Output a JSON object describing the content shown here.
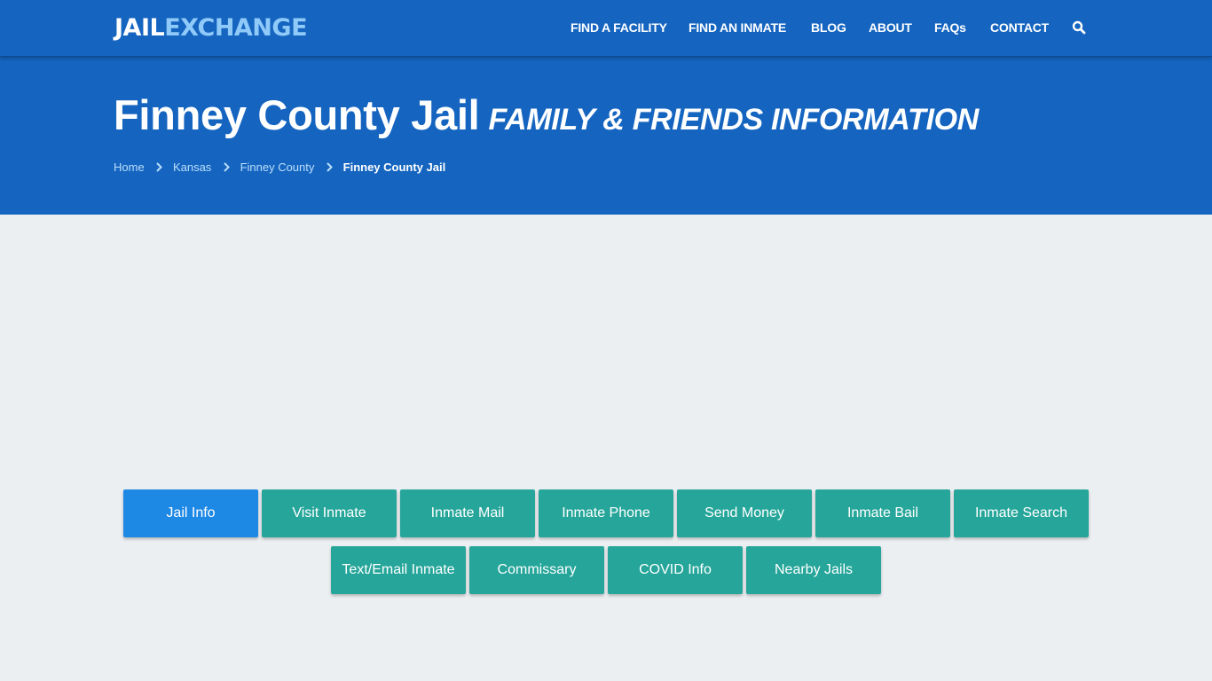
{
  "logo": {
    "part1": "JAIL",
    "part2": "EXCHANGE"
  },
  "nav": {
    "items": [
      {
        "label": "FIND A FACILITY"
      },
      {
        "label": "FIND AN INMATE"
      },
      {
        "label": "BLOG"
      },
      {
        "label": "ABOUT"
      },
      {
        "label": "FAQs"
      },
      {
        "label": "CONTACT"
      }
    ],
    "search_icon": "search-icon"
  },
  "hero": {
    "title": "Finney County Jail",
    "subtitle": "FAMILY & FRIENDS INFORMATION",
    "breadcrumb": [
      {
        "label": "Home"
      },
      {
        "label": "Kansas"
      },
      {
        "label": "Finney County"
      },
      {
        "label": "Finney County Jail"
      }
    ]
  },
  "buttons": {
    "row1": [
      {
        "label": "Jail Info",
        "active": true
      },
      {
        "label": "Visit Inmate"
      },
      {
        "label": "Inmate Mail"
      },
      {
        "label": "Inmate Phone"
      },
      {
        "label": "Send Money"
      },
      {
        "label": "Inmate Bail"
      },
      {
        "label": "Inmate Search"
      }
    ],
    "row2": [
      {
        "label": "Text/Email Inmate"
      },
      {
        "label": "Commissary"
      },
      {
        "label": "COVID Info"
      },
      {
        "label": "Nearby Jails"
      }
    ]
  },
  "colors": {
    "header_blue": "#1565c0",
    "button_teal": "#26a69a",
    "button_active": "#1e88e5",
    "logo_accent": "#90caf9"
  }
}
